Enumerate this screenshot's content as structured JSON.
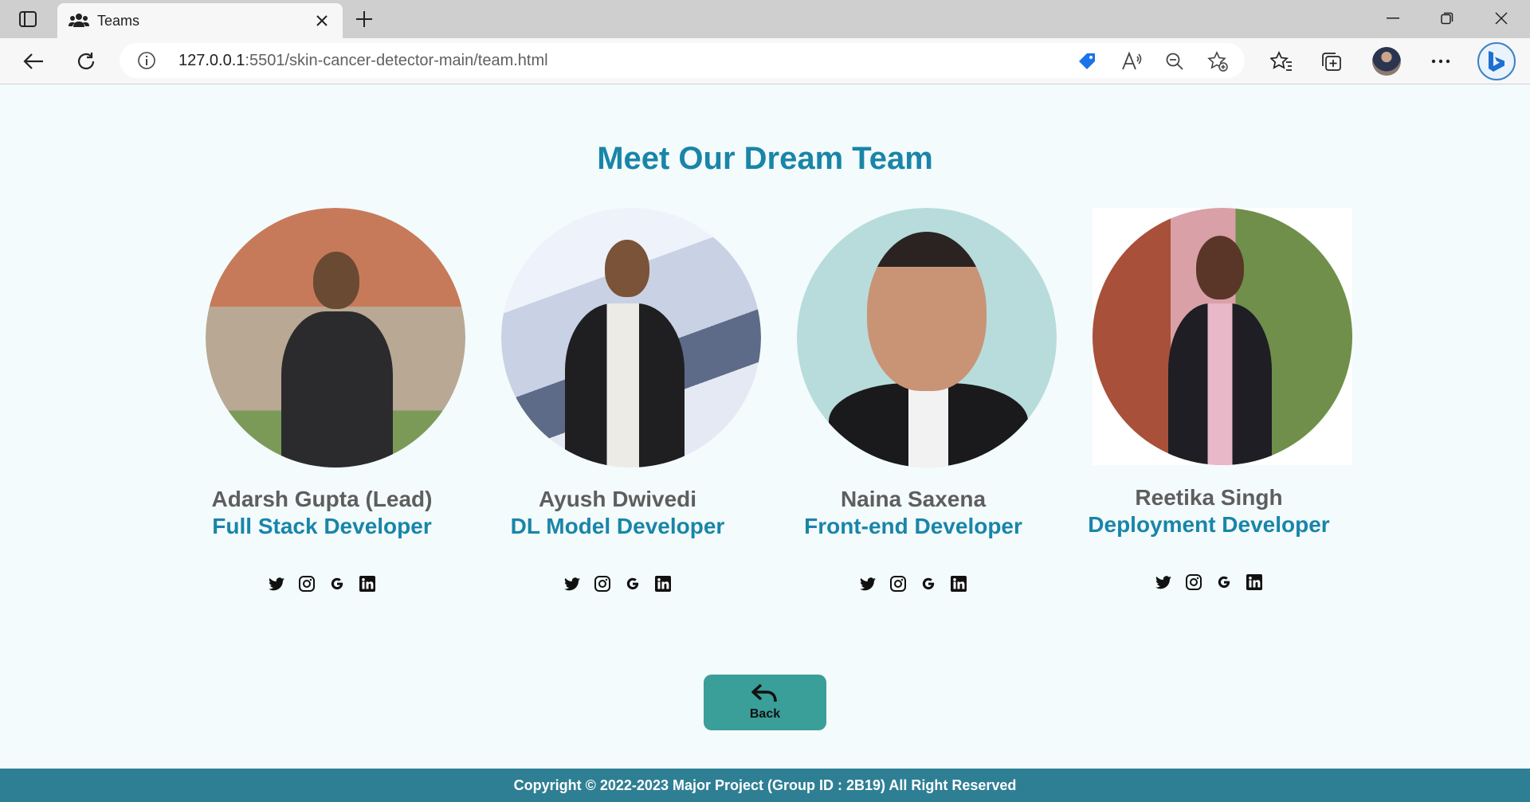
{
  "browser": {
    "tab_title": "Teams",
    "url_host": "127.0.0.1",
    "url_rest": ":5501/skin-cancer-detector-main/team.html"
  },
  "page": {
    "heading": "Meet Our Dream Team",
    "members": [
      {
        "name": "Adarsh Gupta (Lead)",
        "role": "Full Stack Developer"
      },
      {
        "name": "Ayush Dwivedi",
        "role": "DL Model Developer"
      },
      {
        "name": "Naina Saxena",
        "role": "Front-end Developer"
      },
      {
        "name": "Reetika Singh",
        "role": "Deployment Developer"
      }
    ],
    "social_icons": [
      "twitter-icon",
      "instagram-icon",
      "google-icon",
      "linkedin-icon"
    ],
    "back_label": "Back",
    "footer": "Copyright © 2022-2023 Major Project (Group ID : 2B19) All Right Reserved"
  },
  "colors": {
    "accent": "#1985a8",
    "name_text": "#5e5e5e",
    "back_button": "#3a9e99",
    "footer_bg": "#2f7f94",
    "page_bg": "#f3fbfc"
  }
}
